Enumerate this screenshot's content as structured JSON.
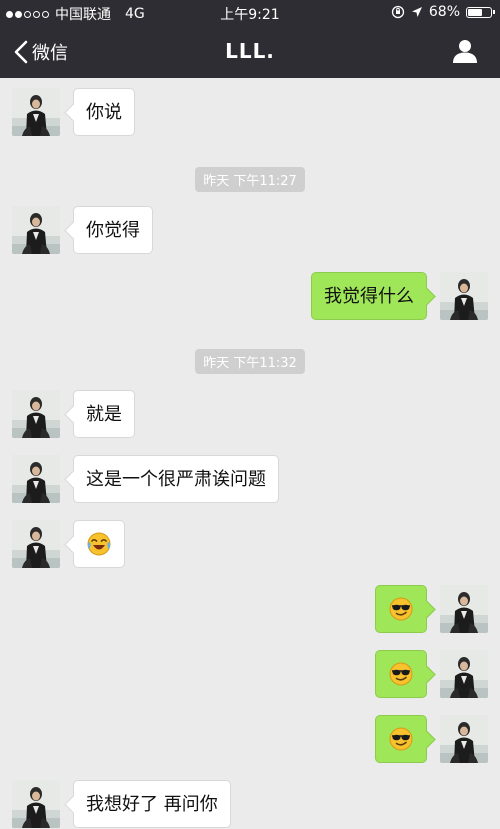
{
  "status": {
    "carrier": "中国联通",
    "network": "4G",
    "time": "上午9:21",
    "battery": "68%",
    "battery_level": 0.68
  },
  "nav": {
    "back_label": "微信",
    "title": "LLL.",
    "profile_icon": "person-icon"
  },
  "messages": {
    "m1": "你说",
    "ts1": "昨天 下午11:27",
    "m2": "你觉得",
    "m3": "我觉得什么",
    "ts2": "昨天 下午11:32",
    "m4": "就是",
    "m5": "这是一个很严肃诶问题",
    "m6_icon": "laughing-emoji-icon",
    "m7_icon": "sunglasses-emoji-icon",
    "m8_icon": "sunglasses-emoji-icon",
    "m9_icon": "sunglasses-emoji-icon",
    "m10": "我想好了 再问你"
  },
  "colors": {
    "header_bg": "#2e2d33",
    "chat_bg": "#ebebeb",
    "sent_bubble": "#9fe658",
    "received_bubble": "#ffffff"
  }
}
